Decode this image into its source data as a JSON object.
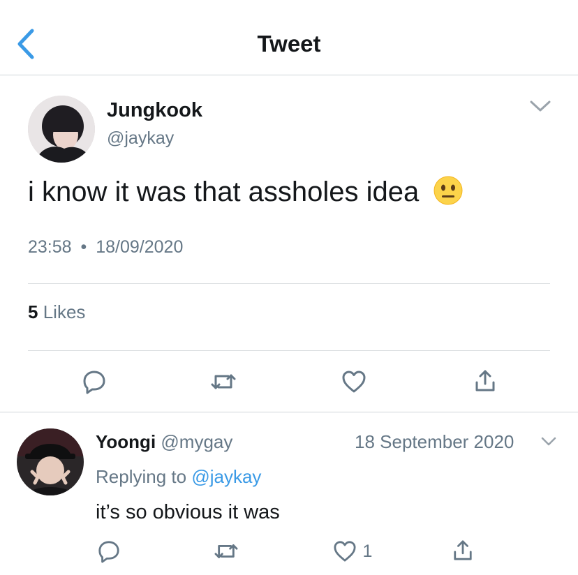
{
  "header": {
    "title": "Tweet",
    "back_icon": "chevron-left-icon"
  },
  "tweet": {
    "author_name": "Jungkook",
    "author_handle": "@jaykay",
    "text": "i know it was that assholes idea",
    "emoji": "neutral-face-emoji",
    "time": "23:58",
    "separator": "•",
    "date": "18/09/2020",
    "likes_count": "5",
    "likes_label": "Likes"
  },
  "actions": [
    "reply-icon",
    "retweet-icon",
    "like-icon",
    "share-icon"
  ],
  "reply": {
    "author_name": "Yoongi",
    "author_handle": "@mygay",
    "date": "18 September 2020",
    "replying_to_label": "Replying to",
    "replying_to_handle": "@jaykay",
    "text": "it’s so obvious it was",
    "like_count": "1"
  },
  "colors": {
    "accent": "#3a9ae6",
    "muted": "#657786",
    "divider": "#d6dadd"
  }
}
